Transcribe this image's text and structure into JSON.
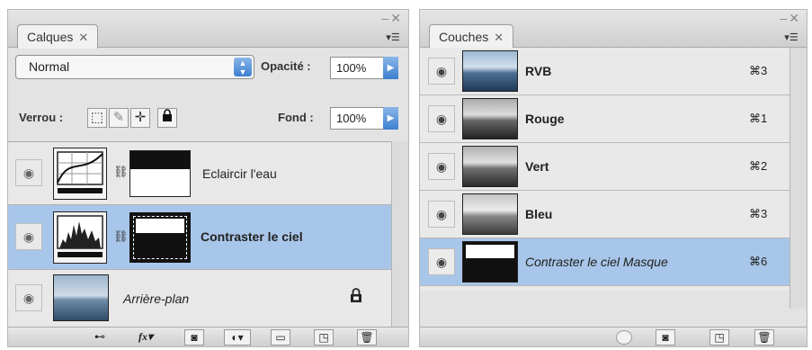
{
  "layers_panel": {
    "tab_label": "Calques",
    "blend_mode": "Normal",
    "opacity_label": "Opacité :",
    "opacity_value": "100%",
    "lock_label": "Verrou :",
    "fill_label": "Fond :",
    "fill_value": "100%",
    "layers": [
      {
        "name": "Eclaircir l'eau",
        "type": "curves-adjustment",
        "selected": false,
        "visible": true
      },
      {
        "name": "Contraster le ciel",
        "type": "levels-adjustment",
        "selected": true,
        "visible": true
      },
      {
        "name": "Arrière-plan",
        "type": "background",
        "selected": false,
        "visible": true,
        "locked": true
      }
    ],
    "bottom_icons": [
      "link-icon",
      "fx-icon",
      "mask-icon",
      "adjustment-icon",
      "group-folder-icon",
      "new-layer-icon",
      "trash-icon"
    ],
    "fx_label": "fx"
  },
  "channels_panel": {
    "tab_label": "Couches",
    "channels": [
      {
        "name": "RVB",
        "shortcut": "⌘3",
        "selected": false
      },
      {
        "name": "Rouge",
        "shortcut": "⌘1",
        "selected": false
      },
      {
        "name": "Vert",
        "shortcut": "⌘2",
        "selected": false
      },
      {
        "name": "Bleu",
        "shortcut": "⌘3",
        "selected": false
      },
      {
        "name": "Contraster le ciel Masque",
        "shortcut": "⌘6",
        "selected": true
      }
    ],
    "bottom_icons": [
      "load-selection-icon",
      "save-selection-icon",
      "new-channel-icon",
      "trash-icon"
    ]
  },
  "colors": {
    "selection": "#a8c6e9",
    "panel_bg": "#e3e3e3",
    "accent_blue": "#3d7fd0"
  }
}
